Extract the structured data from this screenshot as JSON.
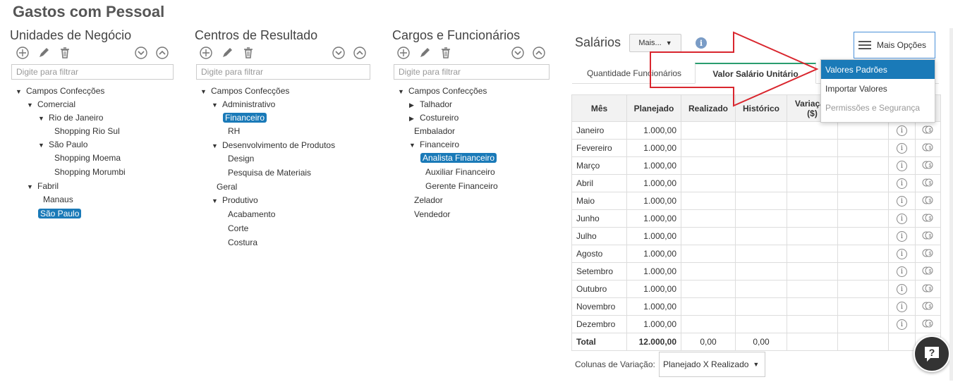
{
  "page_title": "Gastos com Pessoal",
  "filter_placeholder": "Digite para filtrar",
  "panels": {
    "unidades": {
      "title": "Unidades de Negócio",
      "nodes": [
        {
          "label": "Campos Confecções",
          "caret": "▼"
        },
        {
          "label": "Comercial",
          "caret": "▼"
        },
        {
          "label": "Rio de Janeiro",
          "caret": "▼"
        },
        {
          "label": "Shopping Rio Sul",
          "caret": ""
        },
        {
          "label": "São Paulo",
          "caret": "▼"
        },
        {
          "label": "Shopping Moema",
          "caret": ""
        },
        {
          "label": "Shopping Morumbi",
          "caret": ""
        },
        {
          "label": "Fabril",
          "caret": "▼"
        },
        {
          "label": "Manaus",
          "caret": ""
        },
        {
          "label": "São Paulo",
          "caret": "",
          "selected": true
        }
      ]
    },
    "centros": {
      "title": "Centros de Resultado",
      "nodes": [
        {
          "label": "Campos Confecções",
          "caret": "▼"
        },
        {
          "label": "Administrativo",
          "caret": "▼"
        },
        {
          "label": "Financeiro",
          "caret": "",
          "selected": true
        },
        {
          "label": "RH",
          "caret": ""
        },
        {
          "label": "Desenvolvimento de Produtos",
          "caret": "▼"
        },
        {
          "label": "Design",
          "caret": ""
        },
        {
          "label": "Pesquisa de Materiais",
          "caret": ""
        },
        {
          "label": "Geral",
          "caret": ""
        },
        {
          "label": "Produtivo",
          "caret": "▼"
        },
        {
          "label": "Acabamento",
          "caret": ""
        },
        {
          "label": "Corte",
          "caret": ""
        },
        {
          "label": "Costura",
          "caret": ""
        }
      ]
    },
    "cargos": {
      "title": "Cargos e Funcionários",
      "nodes": [
        {
          "label": "Campos Confecções",
          "caret": "▼"
        },
        {
          "label": "Talhador",
          "caret": "▶"
        },
        {
          "label": "Costureiro",
          "caret": "▶"
        },
        {
          "label": "Embalador",
          "caret": ""
        },
        {
          "label": "Financeiro",
          "caret": "▼"
        },
        {
          "label": "Analista Financeiro",
          "caret": "",
          "selected": true
        },
        {
          "label": "Auxiliar Financeiro",
          "caret": ""
        },
        {
          "label": "Gerente Financeiro",
          "caret": ""
        },
        {
          "label": "Zelador",
          "caret": ""
        },
        {
          "label": "Vendedor",
          "caret": ""
        }
      ]
    }
  },
  "salarios": {
    "title": "Salários",
    "mais_label": "Mais...",
    "opts_label": "Mais Opções",
    "tabs": [
      "Quantidade Funcionários",
      "Valor Salário Unitário"
    ],
    "columns": [
      "Mês",
      "Planejado",
      "Realizado",
      "Histórico",
      "Variação ($)"
    ],
    "rows": [
      {
        "mes": "Janeiro",
        "planejado": "1.000,00"
      },
      {
        "mes": "Fevereiro",
        "planejado": "1.000,00"
      },
      {
        "mes": "Março",
        "planejado": "1.000,00"
      },
      {
        "mes": "Abril",
        "planejado": "1.000,00"
      },
      {
        "mes": "Maio",
        "planejado": "1.000,00"
      },
      {
        "mes": "Junho",
        "planejado": "1.000,00"
      },
      {
        "mes": "Julho",
        "planejado": "1.000,00"
      },
      {
        "mes": "Agosto",
        "planejado": "1.000,00"
      },
      {
        "mes": "Setembro",
        "planejado": "1.000,00"
      },
      {
        "mes": "Outubro",
        "planejado": "1.000,00"
      },
      {
        "mes": "Novembro",
        "planejado": "1.000,00"
      },
      {
        "mes": "Dezembro",
        "planejado": "1.000,00"
      }
    ],
    "total": {
      "label": "Total",
      "planejado": "12.000,00",
      "realizado": "0,00",
      "historico": "0,00"
    },
    "menu": [
      {
        "label": "Valores Padrões",
        "state": "active"
      },
      {
        "label": "Importar Valores",
        "state": "normal"
      },
      {
        "label": "Permissões e Segurança",
        "state": "disabled"
      }
    ],
    "variacao_label": "Colunas de Variação:",
    "variacao_value": "Planejado X Realizado"
  },
  "colors": {
    "accent": "#1a7ab8",
    "annotation": "#d9262e",
    "tab_active": "#2a9d6f"
  }
}
